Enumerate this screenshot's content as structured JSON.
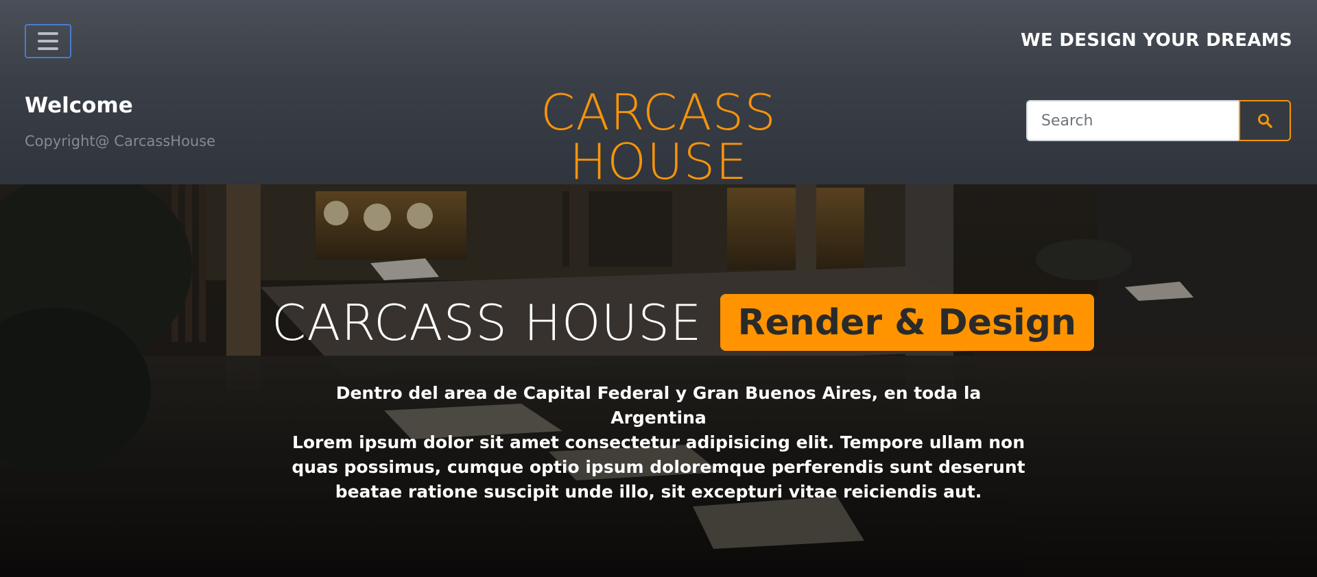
{
  "header": {
    "menu_icon": "hamburger-icon",
    "tagline": "WE DESIGN YOUR DREAMS",
    "welcome": "Welcome",
    "copyright": "Copyright@ CarcassHouse",
    "brand": "CARCASS HOUSE",
    "search": {
      "placeholder": "Search",
      "button_icon": "search-icon"
    }
  },
  "hero": {
    "title": "CARCASS HOUSE",
    "badge": "Render & Design",
    "lines": [
      "Dentro del area de Capital Federal y Gran Buenos Aires, en toda la Argentina",
      "Lorem ipsum dolor sit amet consectetur adipisicing elit. Tempore ullam non",
      "quas possimus, cumque optio ipsum doloremque perferendis sunt deserunt",
      "beatae ratione suscipit unde illo, sit excepturi vitae reiciendis aut."
    ]
  },
  "colors": {
    "accent": "#ff9400",
    "brand": "#f7940a",
    "header_bg": "#343a40",
    "focus_border": "#4a7ccf"
  }
}
